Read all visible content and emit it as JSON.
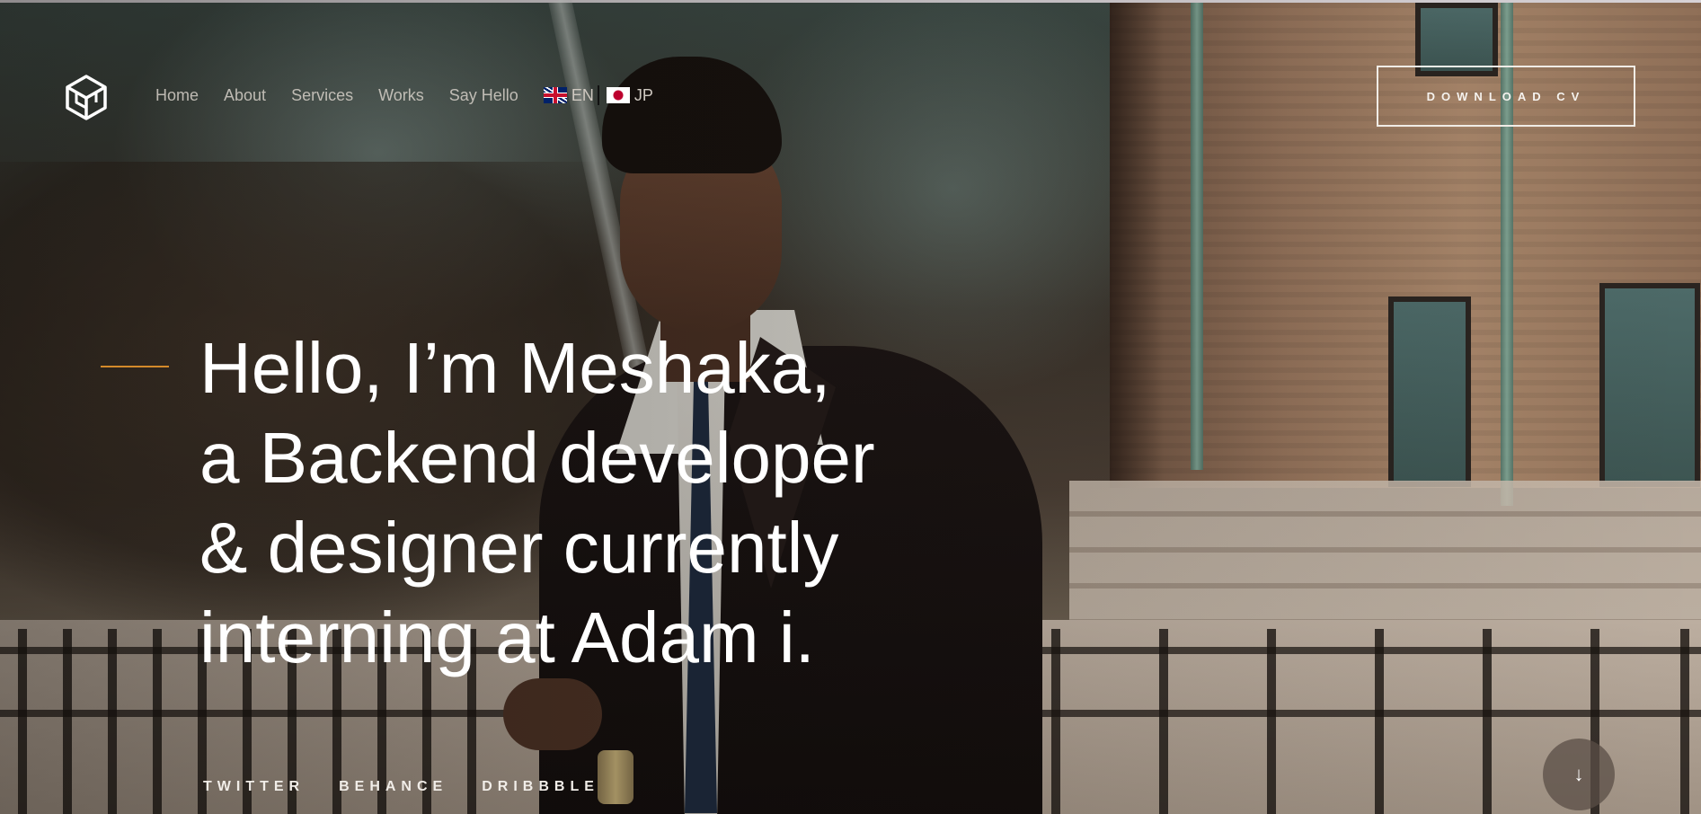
{
  "header": {
    "logo_icon": "cube-logo-icon",
    "nav": {
      "home": "Home",
      "about": "About",
      "services": "Services",
      "works": "Works",
      "say_hello": "Say Hello"
    },
    "languages": {
      "en": "EN",
      "jp": "JP"
    },
    "cv_button": "DOWNLOAD CV"
  },
  "hero": {
    "line1": "Hello, I’m Meshaka,",
    "line2": "a Backend developer",
    "line3": "& designer currently",
    "line4": "interning at Adam i."
  },
  "socials": {
    "twitter": "TWITTER",
    "behance": "BEHANCE",
    "dribbble": "DRIBBBLE"
  },
  "scroll": {
    "icon": "arrow-down-icon",
    "glyph": "↓"
  },
  "colors": {
    "accent": "#d48a2a",
    "text": "#ffffff"
  }
}
